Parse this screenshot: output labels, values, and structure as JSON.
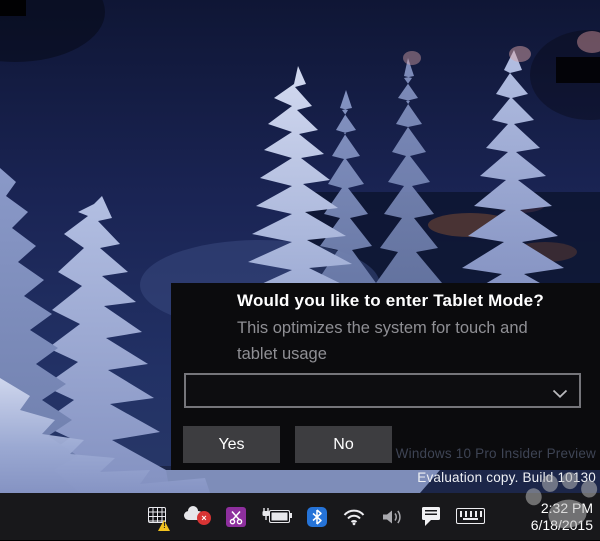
{
  "desktop": {
    "wallpaper_description": "Snow-covered spruce trees in a dark navy winter night forest",
    "watermarks": {
      "insider": "Windows 10 Pro Insider Preview",
      "evaluation": "Evaluation copy. Build 10130"
    }
  },
  "dialog": {
    "title": "Would you like to enter Tablet Mode?",
    "body": "This optimizes the system for touch and tablet usage",
    "dropdown": {
      "value": "",
      "chevron_icon": "chevron-down"
    },
    "buttons": {
      "yes": "Yes",
      "no": "No"
    }
  },
  "taskbar": {
    "tray_icons": [
      {
        "name": "windows-update-warning-icon",
        "badge_glyph": "!"
      },
      {
        "name": "onedrive-error-icon",
        "badge_glyph": "×"
      },
      {
        "name": "onenote-clip-icon",
        "glyph": "✂"
      },
      {
        "name": "battery-plugged-icon"
      },
      {
        "name": "bluetooth-icon"
      },
      {
        "name": "wifi-icon"
      },
      {
        "name": "volume-icon"
      },
      {
        "name": "action-center-icon"
      },
      {
        "name": "touch-keyboard-icon"
      }
    ],
    "clock": {
      "time": "2:32 PM",
      "date": "6/18/2015"
    }
  },
  "colors": {
    "toast_bg": "#0b0b0d",
    "button_bg": "#3d3d40",
    "taskbar_bg": "#18181b",
    "warning_yellow": "#f2c21f",
    "onedrive_error_red": "#d83434",
    "onenote_purple": "#8e2f9e",
    "bluetooth_blue": "#2573d8",
    "sky_navy": "#1a2454",
    "snow_blue": "#a9b5d9"
  }
}
